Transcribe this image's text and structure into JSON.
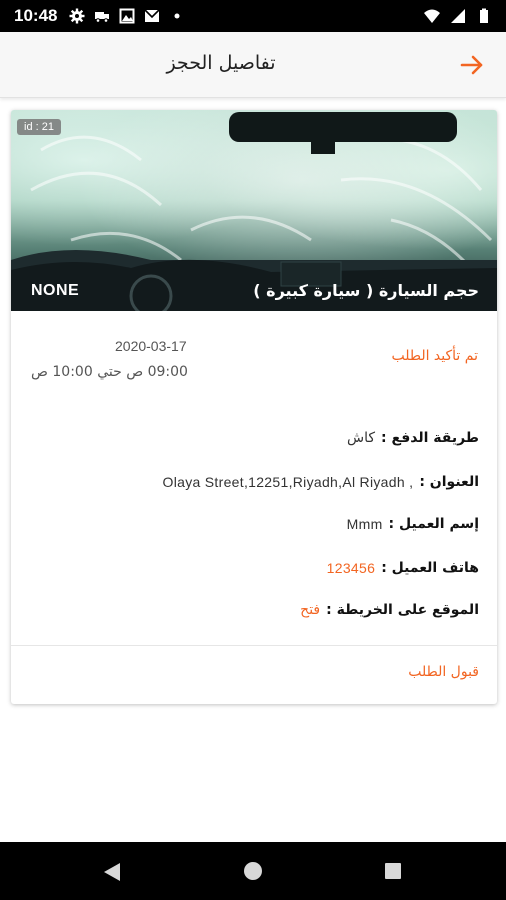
{
  "status_bar": {
    "time": "10:48",
    "icons_left": [
      "gear-icon",
      "truck-icon",
      "image-icon",
      "mail-icon",
      "dot-icon"
    ],
    "icons_right": [
      "wifi-icon",
      "signal-icon",
      "battery-icon"
    ]
  },
  "app_bar": {
    "title": "تفاصيل الحجز",
    "back_icon": "arrow-right-icon",
    "accent_color": "#f26522"
  },
  "booking": {
    "id_badge": "id : 21",
    "hero_none": "NONE",
    "car_size": "حجم السيارة ( سيارة كبيرة )",
    "date": "2020-03-17",
    "time_range": "09:00 ص حتي 10:00 ص",
    "status": "تم تأكيد الطلب",
    "details": {
      "payment_label": "طريقة الدفع :",
      "payment_value": "كاش",
      "address_label": "العنوان :",
      "address_value": "Olaya Street,12251,Riyadh,Al Riyadh ,",
      "customer_label": "إسم العميل :",
      "customer_value": "Mmm",
      "phone_label": "هاتف العميل :",
      "phone_value": "123456",
      "map_label": "الموقع على الخريطة :",
      "map_value": "فتح"
    },
    "accept_label": "قبول الطلب"
  },
  "nav_bar": {
    "icons": [
      "nav-back-icon",
      "nav-home-icon",
      "nav-recents-icon"
    ]
  }
}
